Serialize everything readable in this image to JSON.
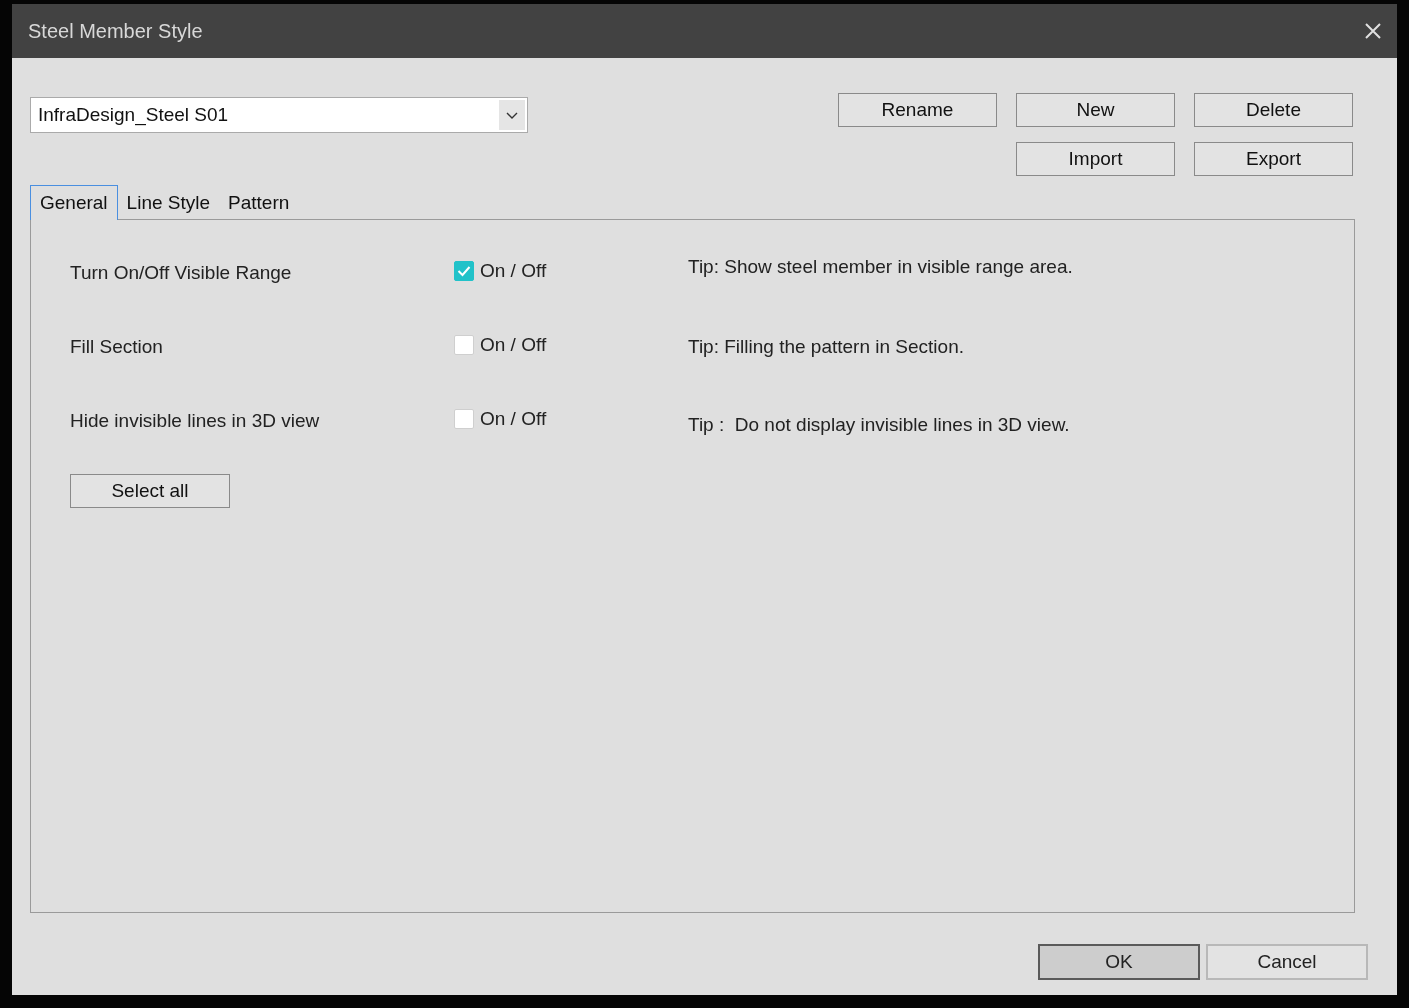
{
  "window": {
    "title": "Steel Member Style"
  },
  "style_select": {
    "value": "InfraDesign_Steel S01"
  },
  "action_rows": [
    [
      "Rename",
      "New",
      "Delete"
    ],
    [
      "Import",
      "Export"
    ]
  ],
  "tabs": [
    {
      "label": "General",
      "selected": true
    },
    {
      "label": "Line Style",
      "selected": false
    },
    {
      "label": "Pattern",
      "selected": false
    }
  ],
  "options": [
    {
      "label": "Turn On/Off Visible Range",
      "checked": true,
      "toggle_label": "On / Off",
      "tip": "Tip: Show steel member in visible range area."
    },
    {
      "label": "Fill Section",
      "checked": false,
      "toggle_label": "On / Off",
      "tip": "Tip: Filling the pattern in Section."
    },
    {
      "label": "Hide invisible lines in 3D view",
      "checked": false,
      "toggle_label": "On / Off",
      "tip": "Tip :  Do not display invisible lines in 3D view."
    }
  ],
  "select_all": "Select all",
  "footer_buttons": [
    {
      "label": "OK",
      "focused": true
    },
    {
      "label": "Cancel",
      "focused": false
    }
  ]
}
